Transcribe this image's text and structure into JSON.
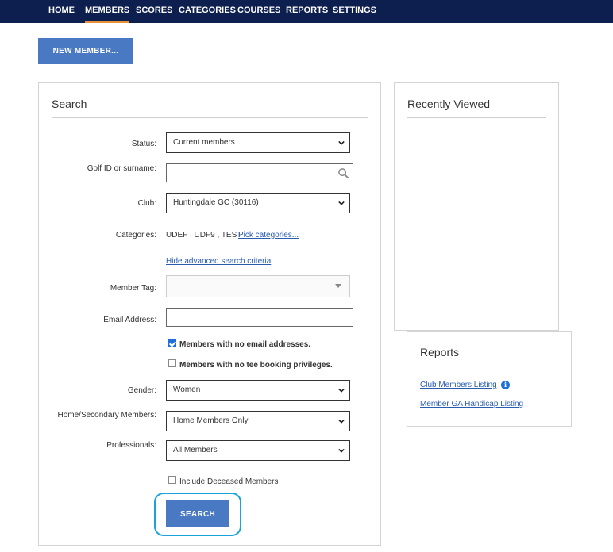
{
  "nav": {
    "items": [
      {
        "label": "HOME"
      },
      {
        "label": "MEMBERS"
      },
      {
        "label": "SCORES"
      },
      {
        "label": "CATEGORIES"
      },
      {
        "label": "COURSES"
      },
      {
        "label": "REPORTS"
      },
      {
        "label": "SETTINGS"
      }
    ],
    "active": "MEMBERS"
  },
  "new_member_label": "NEW MEMBER...",
  "search": {
    "title": "Search",
    "status_label": "Status:",
    "status_value": "Current members",
    "golf_id_label": "Golf ID or surname:",
    "golf_id_value": "",
    "club_label": "Club:",
    "club_value": "Huntingdale GC (30116)",
    "categories_label": "Categories:",
    "categories_value": "UDEF , UDF9 , TEST",
    "pick_categories_label": "Pick categories...",
    "hide_advanced_label": "Hide advanced search criteria",
    "member_tag_label": "Member Tag:",
    "member_tag_value": "",
    "email_label": "Email Address:",
    "email_value": "",
    "no_email_label": "Members with no email addresses.",
    "no_email_checked": true,
    "no_tee_label": "Members with no tee booking privileges.",
    "no_tee_checked": false,
    "gender_label": "Gender:",
    "gender_value": "Women",
    "home_secondary_label": "Home/Secondary Members:",
    "home_secondary_value": "Home Members Only",
    "professionals_label": "Professionals:",
    "professionals_value": "All Members",
    "deceased_label": "Include Deceased Members",
    "deceased_checked": false,
    "search_button_label": "SEARCH"
  },
  "recently_viewed": {
    "title": "Recently Viewed"
  },
  "reports": {
    "title": "Reports",
    "links": [
      {
        "label": "Club Members Listing"
      },
      {
        "label": "Member GA Handicap Listing"
      }
    ]
  },
  "colors": {
    "nav_bg": "#0d1f4f",
    "nav_active_underline": "#e8913a",
    "primary_button": "#4a79c4",
    "link": "#2a5db0",
    "focus_ring": "#1ba3d9"
  },
  "icons": {
    "search_field": "magnifier-icon",
    "select_chevron": "chevron-down-icon",
    "report_info": "info-icon"
  }
}
